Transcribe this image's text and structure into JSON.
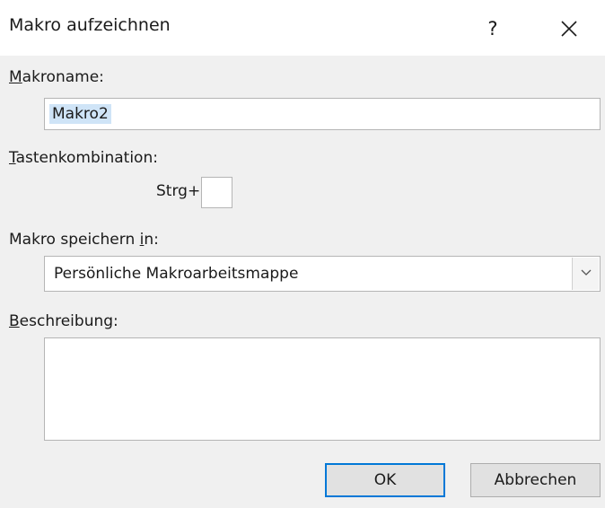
{
  "window": {
    "title": "Makro aufzeichnen",
    "help_label": "?",
    "close_icon": "close-icon"
  },
  "macro_name": {
    "label_first": "M",
    "label_rest": "akroname:",
    "value": "Makro2"
  },
  "shortcut": {
    "label_first": "T",
    "label_rest": "astenkombination:",
    "prefix": "Strg+",
    "value": ""
  },
  "store_in": {
    "label_before": "Makro speichern ",
    "label_underlined": "i",
    "label_after": "n:",
    "selected": "Persönliche Makroarbeitsmappe",
    "dropdown_icon": "chevron-down-icon"
  },
  "description": {
    "label_first": "B",
    "label_rest": "eschreibung:",
    "value": ""
  },
  "buttons": {
    "ok": "OK",
    "cancel": "Abbrechen"
  },
  "colors": {
    "accent": "#0078d7",
    "selection": "#cfe4f7",
    "dialog_bg": "#f0f0f0"
  }
}
